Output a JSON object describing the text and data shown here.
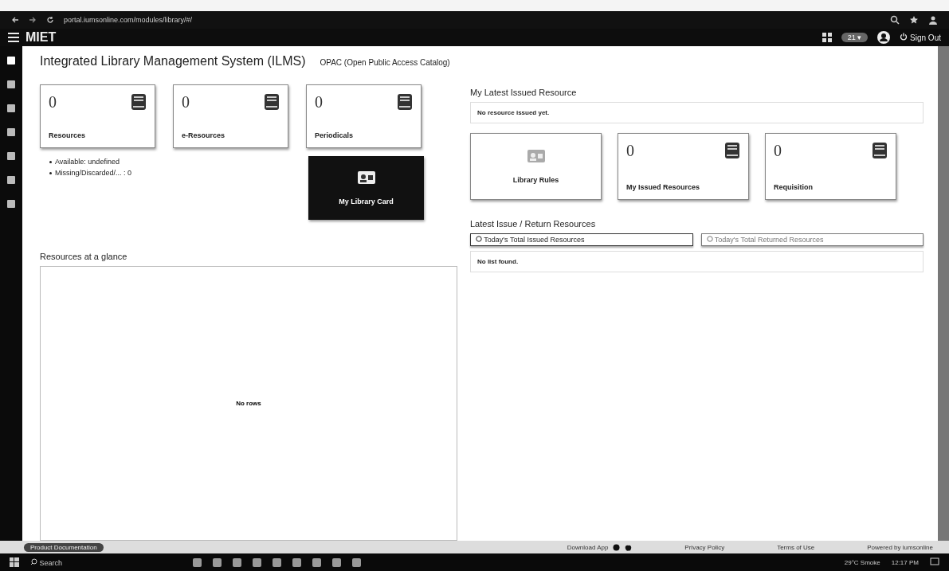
{
  "browser": {
    "url": "portal.iumsonline.com/modules/library/#/"
  },
  "header": {
    "brand": "MIET",
    "session_badge": "21 ▾",
    "sign_out": "Sign Out"
  },
  "sidebar": {
    "items": [
      {
        "selected": true
      },
      {
        "selected": false
      },
      {
        "selected": false
      },
      {
        "selected": false
      },
      {
        "selected": false
      },
      {
        "selected": false
      },
      {
        "selected": false
      }
    ]
  },
  "page": {
    "title": "Integrated Library Management System (ILMS)",
    "opac_link": "OPAC (Open Public Access Catalog)"
  },
  "left_cards": [
    {
      "kind": "stat",
      "count": "0",
      "label": "Resources"
    },
    {
      "kind": "stat",
      "count": "0",
      "label": "e-Resources"
    },
    {
      "kind": "stat",
      "count": "0",
      "label": "Periodicals"
    }
  ],
  "resource_stats": [
    "Available: undefined",
    "Missing/Discarded/... : 0"
  ],
  "library_card": {
    "kind": "dark",
    "label": "My Library Card"
  },
  "glance": {
    "title": "Resources at a glance",
    "empty_text": "No rows"
  },
  "latest_issued": {
    "title": "My Latest Issued Resource",
    "empty_text": "No resource issued yet."
  },
  "right_cards": [
    {
      "kind": "link",
      "label": "Library Rules"
    },
    {
      "kind": "stat",
      "count": "0",
      "label": "My Issued Resources"
    },
    {
      "kind": "stat",
      "count": "0",
      "label": "Requisition"
    }
  ],
  "issue_return": {
    "title": "Latest Issue / Return Resources",
    "tabs": [
      {
        "label": "Today's Total Issued Resources",
        "selected": true
      },
      {
        "label": "Today's Total Returned Resources",
        "selected": false
      }
    ],
    "empty_text": "No list found."
  },
  "footer": {
    "doc_badge": "Product Documentation",
    "download": "Download App",
    "privacy": "Privacy Policy",
    "terms": "Terms of Use",
    "powered": "Powered by iumsonline"
  },
  "taskbar": {
    "search": "Search",
    "weather": "29°C Smoke",
    "time": "12:17 PM"
  }
}
